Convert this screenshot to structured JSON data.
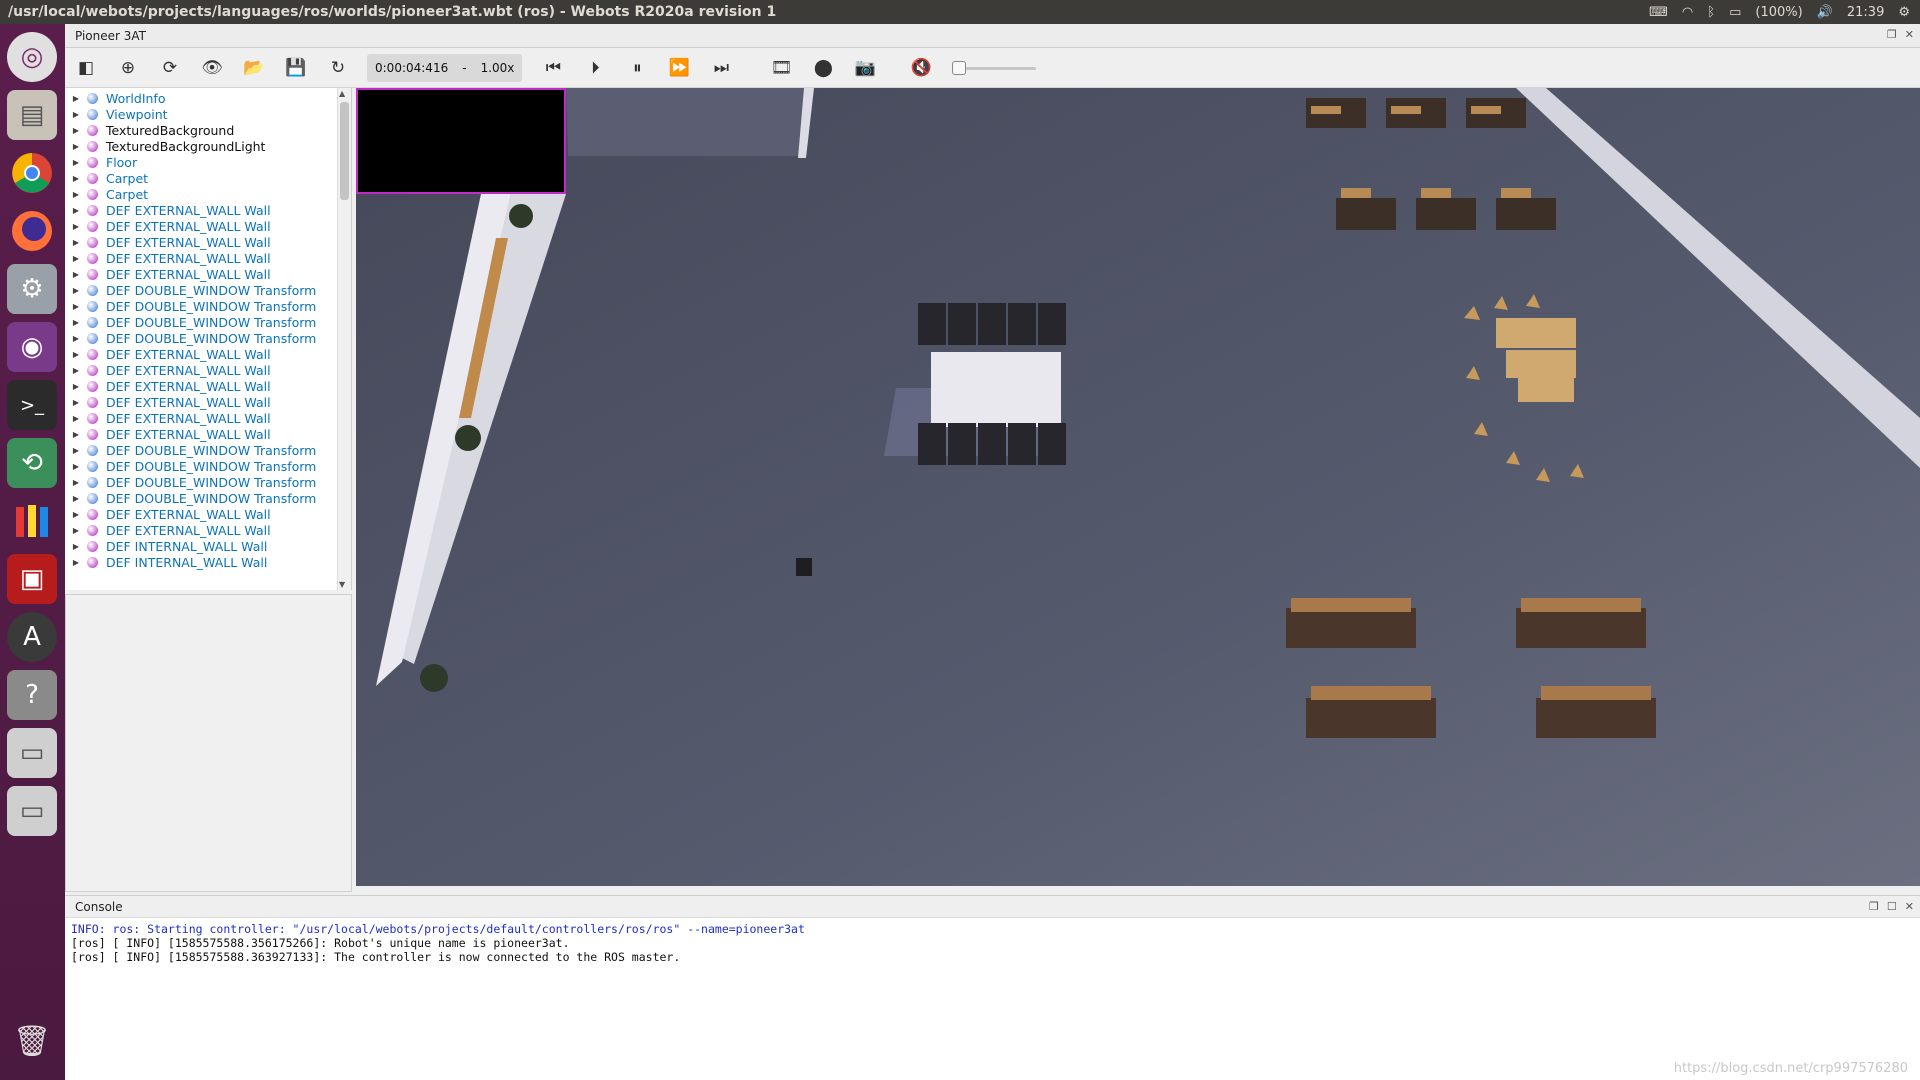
{
  "topbar": {
    "title": "/usr/local/webots/projects/languages/ros/worlds/pioneer3at.wbt (ros) - Webots R2020a revision 1",
    "battery": "(100%)",
    "time": "21:39"
  },
  "window": {
    "title": "Pioneer 3AT"
  },
  "toolbar": {
    "sim_time": "0:00:04:416",
    "speed_sep": "-",
    "speed": "1.00x"
  },
  "tree": {
    "items": [
      {
        "label": "WorldInfo",
        "color": "#2f6fd8",
        "text": "#0d73b9"
      },
      {
        "label": "Viewpoint",
        "color": "#2f6fd8",
        "text": "#0d73b9"
      },
      {
        "label": "TexturedBackground",
        "color": "#b01fc1",
        "text": "#111111"
      },
      {
        "label": "TexturedBackgroundLight",
        "color": "#b01fc1",
        "text": "#111111"
      },
      {
        "label": "Floor",
        "color": "#b01fc1",
        "text": "#0d73b9"
      },
      {
        "label": "Carpet",
        "color": "#b01fc1",
        "text": "#0d73b9"
      },
      {
        "label": "Carpet",
        "color": "#b01fc1",
        "text": "#0d73b9"
      },
      {
        "label": "DEF EXTERNAL_WALL Wall",
        "color": "#b01fc1",
        "text": "#0d73b9"
      },
      {
        "label": "DEF EXTERNAL_WALL Wall",
        "color": "#b01fc1",
        "text": "#0d73b9"
      },
      {
        "label": "DEF EXTERNAL_WALL Wall",
        "color": "#b01fc1",
        "text": "#0d73b9"
      },
      {
        "label": "DEF EXTERNAL_WALL Wall",
        "color": "#b01fc1",
        "text": "#0d73b9"
      },
      {
        "label": "DEF EXTERNAL_WALL Wall",
        "color": "#b01fc1",
        "text": "#0d73b9"
      },
      {
        "label": "DEF DOUBLE_WINDOW Transform",
        "color": "#2f6fd8",
        "text": "#0d73b9"
      },
      {
        "label": "DEF DOUBLE_WINDOW Transform",
        "color": "#2f6fd8",
        "text": "#0d73b9"
      },
      {
        "label": "DEF DOUBLE_WINDOW Transform",
        "color": "#2f6fd8",
        "text": "#0d73b9"
      },
      {
        "label": "DEF DOUBLE_WINDOW Transform",
        "color": "#2f6fd8",
        "text": "#0d73b9"
      },
      {
        "label": "DEF EXTERNAL_WALL Wall",
        "color": "#b01fc1",
        "text": "#0d73b9"
      },
      {
        "label": "DEF EXTERNAL_WALL Wall",
        "color": "#b01fc1",
        "text": "#0d73b9"
      },
      {
        "label": "DEF EXTERNAL_WALL Wall",
        "color": "#b01fc1",
        "text": "#0d73b9"
      },
      {
        "label": "DEF EXTERNAL_WALL Wall",
        "color": "#b01fc1",
        "text": "#0d73b9"
      },
      {
        "label": "DEF EXTERNAL_WALL Wall",
        "color": "#b01fc1",
        "text": "#0d73b9"
      },
      {
        "label": "DEF EXTERNAL_WALL Wall",
        "color": "#b01fc1",
        "text": "#0d73b9"
      },
      {
        "label": "DEF DOUBLE_WINDOW Transform",
        "color": "#2f6fd8",
        "text": "#0d73b9"
      },
      {
        "label": "DEF DOUBLE_WINDOW Transform",
        "color": "#2f6fd8",
        "text": "#0d73b9"
      },
      {
        "label": "DEF DOUBLE_WINDOW Transform",
        "color": "#2f6fd8",
        "text": "#0d73b9"
      },
      {
        "label": "DEF DOUBLE_WINDOW Transform",
        "color": "#2f6fd8",
        "text": "#0d73b9"
      },
      {
        "label": "DEF EXTERNAL_WALL Wall",
        "color": "#b01fc1",
        "text": "#0d73b9"
      },
      {
        "label": "DEF EXTERNAL_WALL Wall",
        "color": "#b01fc1",
        "text": "#0d73b9"
      },
      {
        "label": "DEF INTERNAL_WALL Wall",
        "color": "#b01fc1",
        "text": "#0d73b9"
      },
      {
        "label": "DEF INTERNAL_WALL Wall",
        "color": "#b01fc1",
        "text": "#0d73b9"
      }
    ]
  },
  "console": {
    "title": "Console",
    "lines": [
      "INFO: ros: Starting controller: \"/usr/local/webots/projects/default/controllers/ros/ros\" --name=pioneer3at",
      "[ros] [ INFO] [1585575588.356175266]: Robot's unique name is pioneer3at.",
      "[ros] [ INFO] [1585575588.363927133]: The controller is now connected to the ROS master."
    ]
  },
  "watermark": "https://blog.csdn.net/crp997576280"
}
